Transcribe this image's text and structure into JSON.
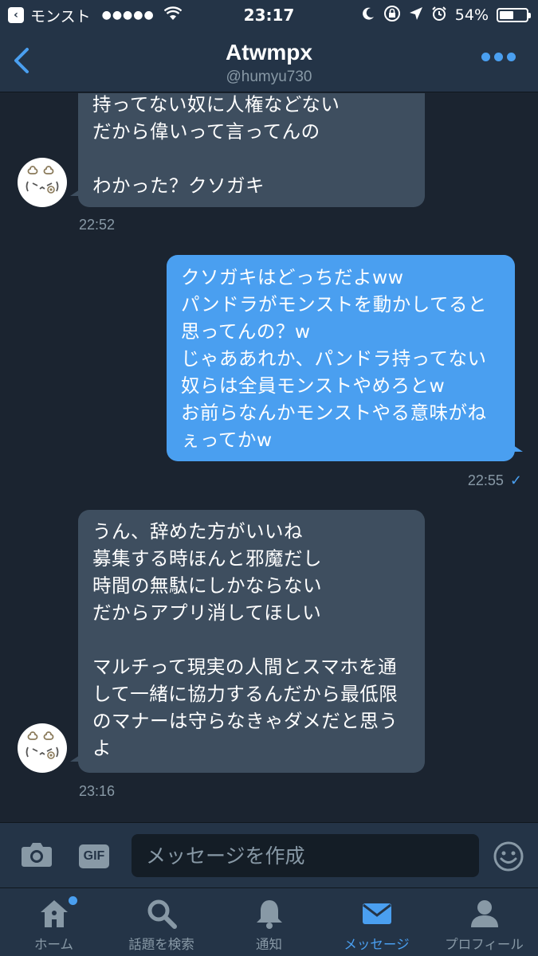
{
  "status_bar": {
    "back_app": "モンスト",
    "signal": "●●●●●",
    "time": "23:17",
    "battery_percent": "54%",
    "battery_level": 0.54
  },
  "header": {
    "name": "Atwmpx",
    "handle": "@humyu730"
  },
  "messages": [
    {
      "direction": "in",
      "text": "持ってない奴に人権などない\nだから偉いって言ってんの\n\nわかった？クソガキ",
      "time": "22:52"
    },
    {
      "direction": "out",
      "text": "クソガキはどっちだよww\nパンドラがモンストを動かしてると思ってんの？w\nじゃああれか、パンドラ持ってない奴らは全員モンストやめろとw\nお前らなんかモンストやる意味がねぇってかw",
      "time": "22:55",
      "read_check": "✓"
    },
    {
      "direction": "in",
      "text": "うん、辞めた方がいいね\n募集する時ほんと邪魔だし\n時間の無駄にしかならない\nだからアプリ消してほしい\n\nマルチって現実の人間とスマホを通して一緒に協力するんだから最低限のマナーは守らなきゃダメだと思うよ",
      "time": "23:16"
    }
  ],
  "composer": {
    "gif_label": "GIF",
    "placeholder": "メッセージを作成"
  },
  "tabs": [
    {
      "label": "ホーム",
      "icon": "home-icon"
    },
    {
      "label": "話題を検索",
      "icon": "search-icon"
    },
    {
      "label": "通知",
      "icon": "bell-icon"
    },
    {
      "label": "メッセージ",
      "icon": "envelope-icon",
      "active": true
    },
    {
      "label": "プロフィール",
      "icon": "profile-icon"
    }
  ],
  "colors": {
    "background": "#1b2430",
    "bar": "#243447",
    "accent": "#4a9ff0",
    "incoming_bubble": "#3e4e5f",
    "muted": "#8899a6"
  }
}
